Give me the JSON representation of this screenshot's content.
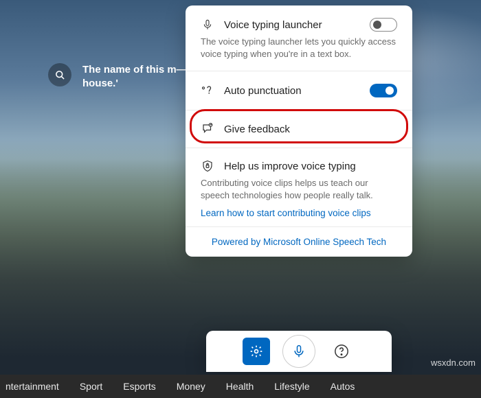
{
  "search": {
    "text": "The name of this m— house.'"
  },
  "card": {
    "launcher": {
      "title": "Voice typing launcher",
      "desc": "The voice typing launcher lets you quickly access voice typing when you're in a text box.",
      "on": false
    },
    "auto_punct": {
      "title": "Auto punctuation",
      "on": true
    },
    "feedback": {
      "title": "Give feedback"
    },
    "improve": {
      "title": "Help us improve voice typing",
      "desc": "Contributing voice clips helps us teach our speech technologies how people really talk.",
      "link": "Learn how to start contributing voice clips"
    },
    "footer": "Powered by Microsoft Online Speech Tech"
  },
  "nav": {
    "items": [
      "ntertainment",
      "Sport",
      "Esports",
      "Money",
      "Health",
      "Lifestyle",
      "Autos"
    ]
  },
  "watermark": "wsxdn.com"
}
